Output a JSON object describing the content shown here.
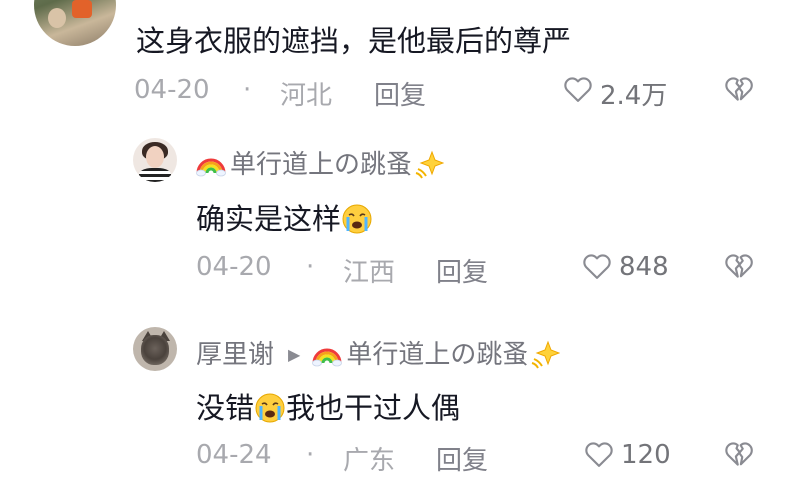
{
  "comment": {
    "text": "这身衣服的遮挡，是他最后的尊严",
    "date": "04-20",
    "dot": "·",
    "location": "河北",
    "reply_label": "回复",
    "likes": "2.4万"
  },
  "replies": [
    {
      "username": "单行道上の跳蚤",
      "text_before": "确实是这样",
      "text_after": "",
      "date": "04-20",
      "dot": "·",
      "location": "江西",
      "reply_label": "回复",
      "likes": "848"
    },
    {
      "username": "厚里谢",
      "reply_to": "单行道上の跳蚤",
      "text_before": "没错",
      "text_after": "我也干过人偶",
      "date": "04-24",
      "dot": "·",
      "location": "广东",
      "reply_label": "回复",
      "likes": "120"
    }
  ],
  "colors": {
    "text_primary": "#161823",
    "meta": "#a8a9ae",
    "username": "#74757d"
  },
  "icons": [
    "heart-outline-icon",
    "broken-heart-icon",
    "rainbow-emoji",
    "sparkle-emoji",
    "crying-face-emoji",
    "reply-arrow-icon"
  ]
}
